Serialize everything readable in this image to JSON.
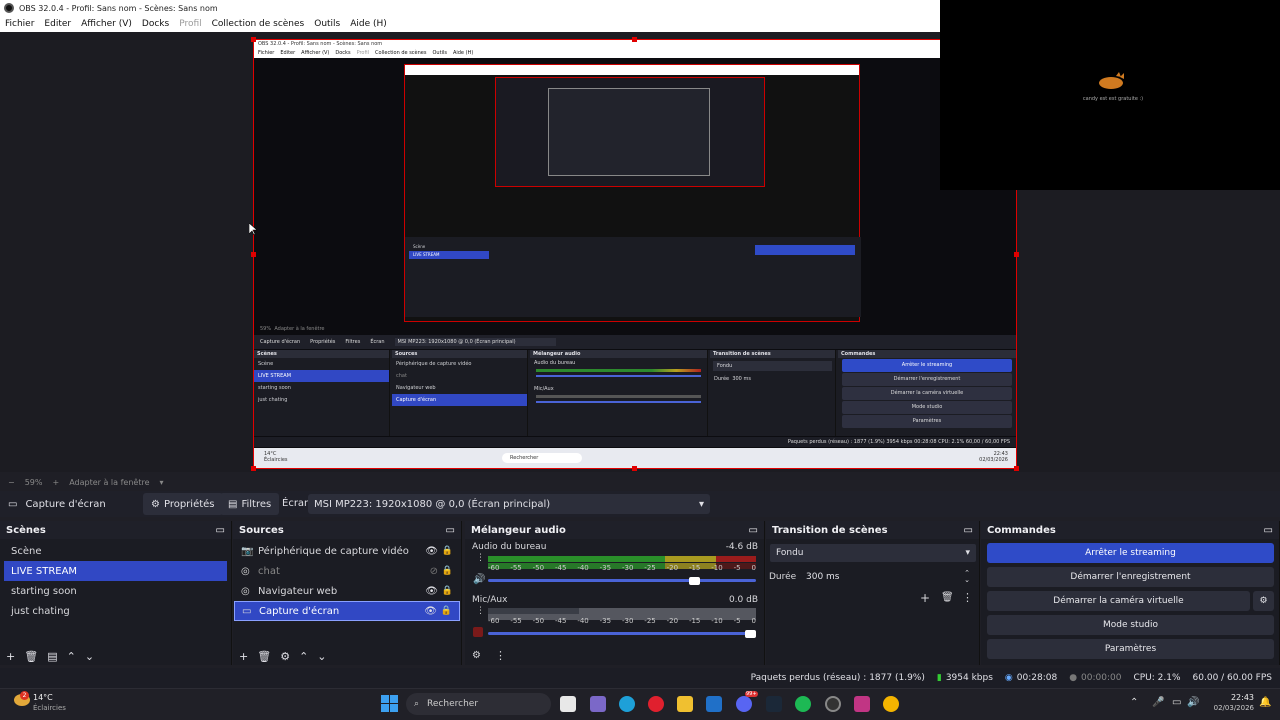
{
  "window": {
    "title": "OBS 32.0.4 - Profil: Sans nom - Scènes: Sans nom"
  },
  "menu": [
    "Fichier",
    "Editer",
    "Afficher (V)",
    "Docks",
    "Profil",
    "Collection de scènes",
    "Outils",
    "Aide (H)"
  ],
  "overlay": {
    "text": "candy est est gratuite :)"
  },
  "nested": {
    "title": "OBS 32.0.4 - Profil: Sans nom - Scènes: Sans nom",
    "menu": [
      "Fichier",
      "Editer",
      "Afficher (V)",
      "Docks",
      "Profil",
      "Collection de scènes",
      "Outils",
      "Aide (H)"
    ],
    "zoom": "59%",
    "fit": "Adapter à la fenêtre",
    "source_name": "Capture d'écran",
    "properties": "Propriétés",
    "filters": "Filtres",
    "screen_label": "Écran",
    "screen_value": "MSI MP223: 1920x1080 @ 0,0 (Écran principal)",
    "scenes_head": "Scènes",
    "sources_head": "Sources",
    "mixer_head": "Mélangeur audio",
    "transition_head": "Transition de scènes",
    "commands_head": "Commandes",
    "scenes": [
      "Scène",
      "LIVE STREAM",
      "starting soon",
      "just chating"
    ],
    "sources": [
      "Périphérique de capture vidéo",
      "chat",
      "Navigateur web",
      "Capture d'écran"
    ],
    "mixer_desktop": "Audio du bureau",
    "mixer_mic": "Mic/Aux",
    "transition": "Fondu",
    "duration_label": "Durée",
    "duration": "300 ms",
    "commands": [
      "Arrêter le streaming",
      "Démarrer l'enregistrement",
      "Démarrer la caméra virtuelle",
      "Mode studio",
      "Paramètres"
    ],
    "status": "Paquets perdus (réseau) : 1877 (1.9%)   3954 kbps   00:28:08   CPU: 2.1%   60,00 / 60,00 FPS",
    "search": "Rechercher",
    "weather": "14°C",
    "weather_sub": "Éclaircies",
    "clock_time": "22:43",
    "clock_date": "02/03/2026"
  },
  "zoombar": {
    "minus": "−",
    "zoom": "59%",
    "plus": "+",
    "fit": "Adapter à la fenêtre"
  },
  "source_toolbar": {
    "source_name": "Capture d'écran",
    "properties": "Propriétés",
    "filters": "Filtres",
    "screen_label": "Écran",
    "screen_value": "MSI MP223: 1920x1080 @ 0,0 (Écran principal)"
  },
  "scenes": {
    "title": "Scènes",
    "items": [
      "Scène",
      "LIVE STREAM",
      "starting soon",
      "just chating"
    ],
    "selected_index": 1
  },
  "sources": {
    "title": "Sources",
    "items": [
      {
        "label": "Périphérique de capture vidéo",
        "visible": true
      },
      {
        "label": "chat",
        "visible": false
      },
      {
        "label": "Navigateur web",
        "visible": true
      },
      {
        "label": "Capture d'écran",
        "visible": true
      }
    ],
    "selected_index": 3
  },
  "mixer": {
    "title": "Mélangeur audio",
    "channels": [
      {
        "name": "Audio du bureau",
        "db": "-4.6 dB",
        "volume_fraction": 0.79
      },
      {
        "name": "Mic/Aux",
        "db": "0.0 dB",
        "volume_fraction": 1.0
      }
    ],
    "scale": [
      "-60",
      "-55",
      "-50",
      "-45",
      "-40",
      "-35",
      "-30",
      "-25",
      "-20",
      "-15",
      "-10",
      "-5",
      "0"
    ]
  },
  "transition": {
    "title": "Transition de scènes",
    "value": "Fondu",
    "duration_label": "Durée",
    "duration": "300 ms"
  },
  "commands": {
    "title": "Commandes",
    "stream": "Arrêter le streaming",
    "record": "Démarrer l'enregistrement",
    "virtualcam": "Démarrer la caméra virtuelle",
    "studio": "Mode studio",
    "settings": "Paramètres"
  },
  "status": {
    "dropped": "Paquets perdus (réseau) : 1877 (1.9%)",
    "bitrate": "3954 kbps",
    "stream_time": "00:28:08",
    "record_time": "00:00:00",
    "cpu": "CPU: 2.1%",
    "fps": "60.00 / 60.00 FPS"
  },
  "taskbar": {
    "weather_temp": "14°C",
    "weather_desc": "Éclaircies",
    "weather_badge": "2",
    "search_placeholder": "Rechercher",
    "time": "22:43",
    "date": "02/03/2026",
    "notif_badge": "99+"
  },
  "colors": {
    "accent": "#3148c4",
    "command_active": "#2f4bc8",
    "selection_border": "#e00000"
  }
}
